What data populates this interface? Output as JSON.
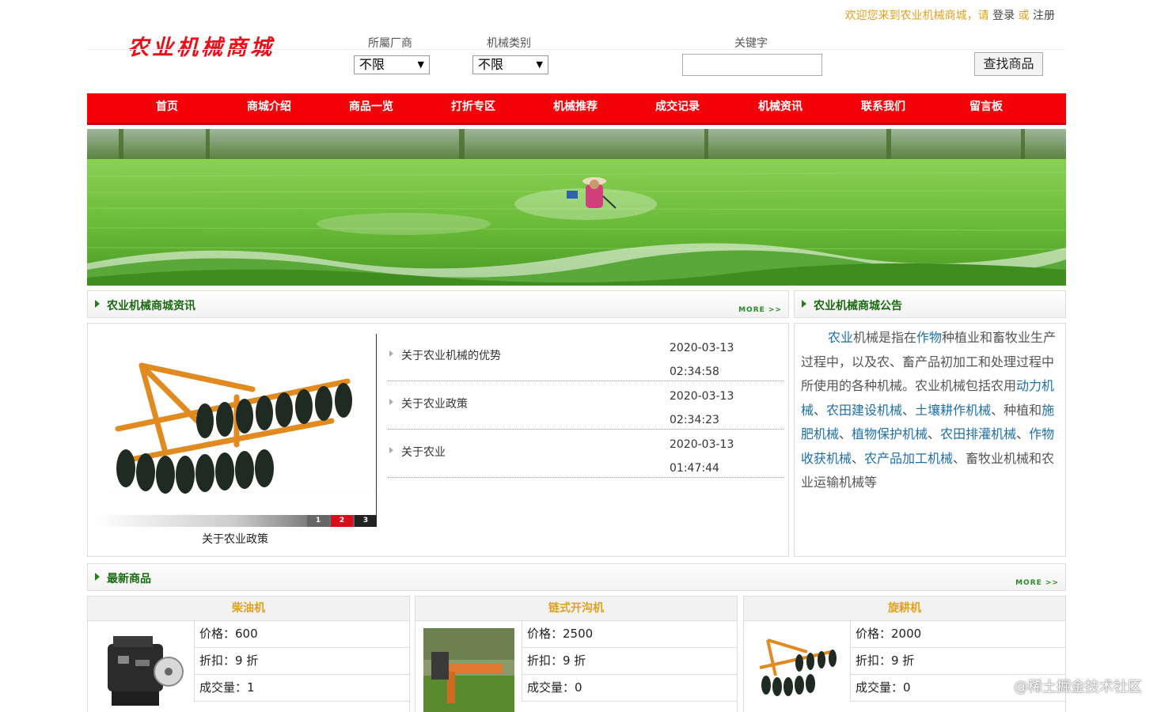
{
  "header": {
    "welcome_prefix": "欢迎您来到农业机械商城，请",
    "login": "登录",
    "or": "或",
    "register": "注册",
    "logo": "农业机械商城"
  },
  "search": {
    "vendor_label": "所屬厂商",
    "vendor_value": "不限",
    "category_label": "机械类别",
    "category_value": "不限",
    "keyword_label": "关键字",
    "keyword_value": "",
    "button": "查找商品"
  },
  "nav": [
    "首页",
    "商城介绍",
    "商品一览",
    "打折专区",
    "机械推荐",
    "成交记录",
    "机械资讯",
    "联系我们",
    "留言板"
  ],
  "news": {
    "title": "农业机械商城资讯",
    "more": "MORE >>",
    "items": [
      {
        "title": "关于农业机械的优势",
        "date": "2020-03-13",
        "time": "02:34:58"
      },
      {
        "title": "关于农业政策",
        "date": "2020-03-13",
        "time": "02:34:23"
      },
      {
        "title": "关于农业",
        "date": "2020-03-13",
        "time": "01:47:44"
      }
    ],
    "slider_buttons": [
      "1",
      "2",
      "3"
    ],
    "slider_caption": "关于农业政策"
  },
  "notice": {
    "title": "农业机械商城公告",
    "t1": "农业",
    "t2": "机械是指在",
    "t3": "作物",
    "t4": "种植业和畜牧业生产过程中，以及农、畜产品初加工和处理过程中所使用的各种机械。农业机械包括农用",
    "t5": "动力机械",
    "t6": "、",
    "t7": "农田建设机械",
    "t8": "、",
    "t9": "土壤耕作机械",
    "t10": "、种植和",
    "t11": "施肥机械",
    "t12": "、",
    "t13": "植物保护机械",
    "t14": "、",
    "t15": "农田排灌机械",
    "t16": "、",
    "t17": "作物收获机械",
    "t18": "、",
    "t19": "农产品加工机械",
    "t20": "、畜牧业机械和农业运输机械等"
  },
  "latest": {
    "title": "最新商品",
    "more": "MORE >>",
    "products": [
      {
        "name": "柴油机",
        "price": "价格：600",
        "discount": "折扣：9 折",
        "sold": "成交量：1"
      },
      {
        "name": "链式开沟机",
        "price": "价格：2500",
        "discount": "折扣：9 折",
        "sold": "成交量：0"
      },
      {
        "name": "旋耕机",
        "price": "价格：2000",
        "discount": "折扣：9 折",
        "sold": "成交量：0"
      }
    ]
  },
  "watermark": "@稀土掘金技术社区",
  "colors": {
    "nav_red": "#f4020a",
    "accent_orange": "#e0a020",
    "section_green": "#1a6a10",
    "link_blue": "#1e6fa8"
  }
}
